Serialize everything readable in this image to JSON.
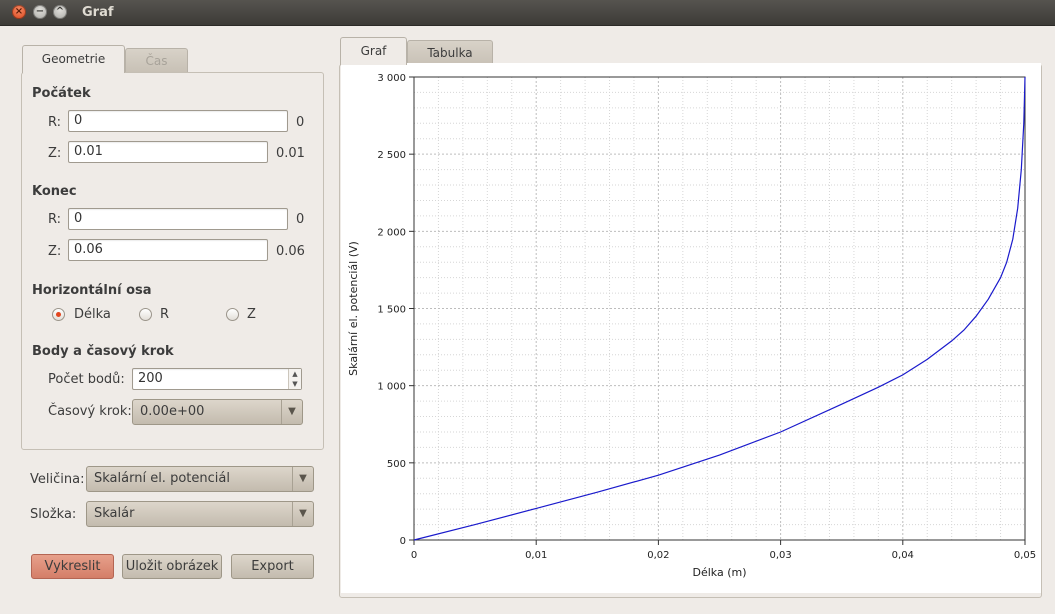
{
  "window": {
    "title": "Graf"
  },
  "left_tabs": {
    "geometry": "Geometrie",
    "time": "Čas"
  },
  "start": {
    "title": "Počátek",
    "r_label": "R:",
    "r_value": "0",
    "r_readout": "0",
    "z_label": "Z:",
    "z_value": "0.01",
    "z_readout": "0.01"
  },
  "end": {
    "title": "Konec",
    "r_label": "R:",
    "r_value": "0",
    "r_readout": "0",
    "z_label": "Z:",
    "z_value": "0.06",
    "z_readout": "0.06"
  },
  "axis_choice": {
    "title": "Horizontální osa",
    "options": [
      "Délka",
      "R",
      "Z"
    ],
    "selected": "Délka"
  },
  "points": {
    "title": "Body a časový krok",
    "count_label": "Počet bodů:",
    "count_value": "200",
    "step_label": "Časový krok:",
    "step_value": "0.00e+00"
  },
  "quantity": {
    "label": "Veličina:",
    "value": "Skalární el. potenciál"
  },
  "component": {
    "label": "Složka:",
    "value": "Skalár"
  },
  "buttons": {
    "plot": "Vykreslit",
    "save_image": "Uložit obrázek",
    "export": "Export"
  },
  "right_tabs": {
    "graph": "Graf",
    "table": "Tabulka"
  },
  "colors": {
    "accent": "#d47e68",
    "line": "#1a1acc",
    "radio_selected": "#e2461f"
  },
  "chart_data": {
    "type": "line",
    "xlabel": "Délka (m)",
    "ylabel": "Skalární el. potenciál (V)",
    "xlim": [
      0,
      0.05
    ],
    "ylim": [
      0,
      3000
    ],
    "x_ticks": [
      "0",
      "0,01",
      "0,02",
      "0,03",
      "0,04",
      "0,05"
    ],
    "y_ticks": [
      "0",
      "500",
      "1 000",
      "1 500",
      "2 000",
      "2 500",
      "3 000"
    ],
    "grid": true,
    "series": [
      {
        "x": [
          0,
          0.005,
          0.01,
          0.015,
          0.02,
          0.025,
          0.03,
          0.035,
          0.038,
          0.04,
          0.042,
          0.044,
          0.045,
          0.046,
          0.047,
          0.048,
          0.0485,
          0.049,
          0.0494,
          0.0497,
          0.0499,
          0.05
        ],
        "y": [
          0,
          100,
          205,
          310,
          420,
          550,
          700,
          880,
          990,
          1070,
          1170,
          1290,
          1360,
          1450,
          1560,
          1700,
          1800,
          1950,
          2150,
          2400,
          2700,
          3000
        ]
      }
    ]
  }
}
